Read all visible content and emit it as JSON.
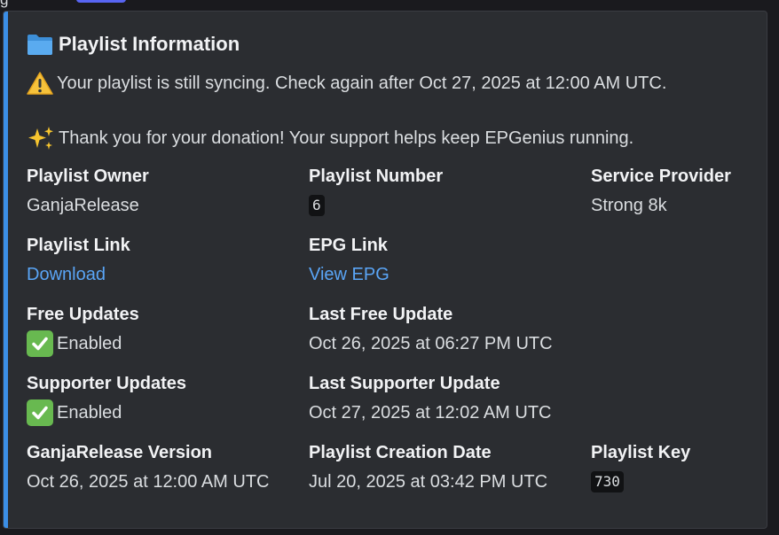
{
  "top": {
    "partial_text": "g"
  },
  "embed": {
    "accent_color": "#3b8ee6",
    "title": "Playlist Information",
    "title_icon": "folder-icon",
    "description": [
      {
        "icon": "warning-icon",
        "text": "Your playlist is still syncing. Check again after Oct 27, 2025 at 12:00 AM UTC."
      },
      {
        "icon": "sparkles-icon",
        "text": "Thank you for your donation! Your support helps keep EPGenius running."
      }
    ],
    "fields": {
      "playlist_owner": {
        "name": "Playlist Owner",
        "value": "GanjaRelease"
      },
      "playlist_number": {
        "name": "Playlist Number",
        "value": "6"
      },
      "service_provider": {
        "name": "Service Provider",
        "value": "Strong 8k"
      },
      "playlist_link": {
        "name": "Playlist Link",
        "value": "Download"
      },
      "epg_link": {
        "name": "EPG Link",
        "value": "View EPG"
      },
      "free_updates": {
        "name": "Free Updates",
        "value": "Enabled",
        "icon": "check-mark-icon"
      },
      "last_free_update": {
        "name": "Last Free Update",
        "value": "Oct 26, 2025 at 06:27 PM UTC"
      },
      "supporter_updates": {
        "name": "Supporter Updates",
        "value": "Enabled",
        "icon": "check-mark-icon"
      },
      "last_supporter_update": {
        "name": "Last Supporter Update",
        "value": "Oct 27, 2025 at 12:02 AM UTC"
      },
      "ganjarelease_version": {
        "name": "GanjaRelease Version",
        "value": "Oct 26, 2025 at 12:00 AM UTC"
      },
      "playlist_creation_date": {
        "name": "Playlist Creation Date",
        "value": "Jul 20, 2025 at 03:42 PM UTC"
      },
      "playlist_key": {
        "name": "Playlist Key",
        "value": "730"
      }
    }
  }
}
